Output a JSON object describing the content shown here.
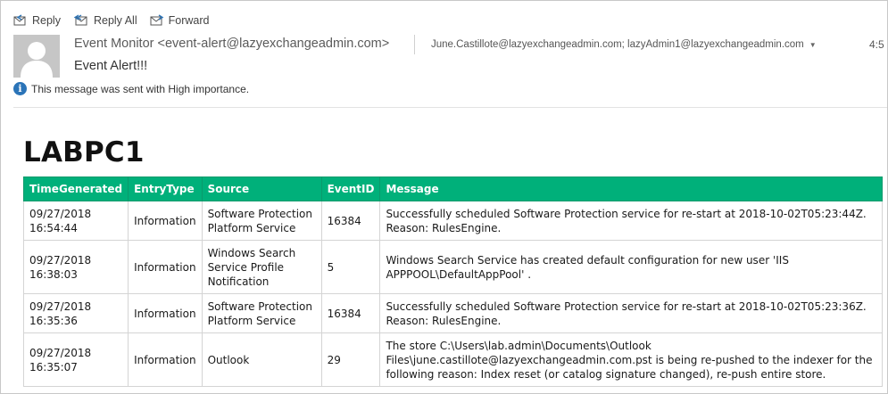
{
  "toolbar": {
    "reply_label": "Reply",
    "reply_all_label": "Reply All",
    "forward_label": "Forward"
  },
  "header": {
    "sender": "Event Monitor <event-alert@lazyexchangeadmin.com>",
    "recipients": "June.Castillote@lazyexchangeadmin.com; lazyAdmin1@lazyexchangeadmin.com",
    "time": "4:5",
    "subject": "Event Alert!!!",
    "importance_note": "This message was sent with High importance."
  },
  "body": {
    "computer_name": "LABPC1",
    "table": {
      "columns": [
        "TimeGenerated",
        "EntryType",
        "Source",
        "EventID",
        "Message"
      ],
      "rows": [
        {
          "time_date": "09/27/2018",
          "time_clock": "16:54:44",
          "entry_type": "Information",
          "source": "Software Protection Platform Service",
          "event_id": "16384",
          "message": "Successfully scheduled Software Protection service for re-start at 2018-10-02T05:23:44Z. Reason: RulesEngine."
        },
        {
          "time_date": "09/27/2018",
          "time_clock": "16:38:03",
          "entry_type": "Information",
          "source": "Windows Search Service Profile Notification",
          "event_id": "5",
          "message": "Windows Search Service has created default configuration for new user 'IIS APPPOOL\\DefaultAppPool' ."
        },
        {
          "time_date": "09/27/2018",
          "time_clock": "16:35:36",
          "entry_type": "Information",
          "source": "Software Protection Platform Service",
          "event_id": "16384",
          "message": "Successfully scheduled Software Protection service for re-start at 2018-10-02T05:23:36Z. Reason: RulesEngine."
        },
        {
          "time_date": "09/27/2018",
          "time_clock": "16:35:07",
          "entry_type": "Information",
          "source": "Outlook",
          "event_id": "29",
          "message": "The store C:\\Users\\lab.admin\\Documents\\Outlook Files\\june.castillote@lazyexchangeadmin.com.pst is being re-pushed to the indexer for the following reason: Index reset (or catalog signature changed), re-push entire store."
        }
      ]
    }
  },
  "colors": {
    "header_green": "#00b07a",
    "info_blue": "#2b74b8"
  },
  "icons": [
    "reply-icon",
    "reply-all-icon",
    "forward-icon",
    "avatar-placeholder",
    "info-icon",
    "chevron-down-icon"
  ]
}
